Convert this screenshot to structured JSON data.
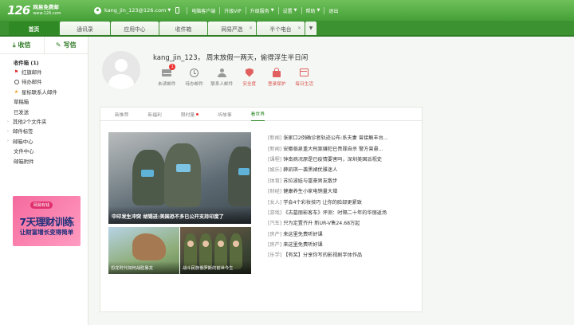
{
  "topbar": {
    "logo_num": "126",
    "logo_name": "网易免费邮",
    "logo_url": "www.126.com",
    "user": "kang_jin_123@126.com",
    "links": [
      "电脑客户端",
      "升级VIP",
      "升级服务",
      "设置",
      "帮助",
      "退出"
    ]
  },
  "tabs": [
    {
      "label": "首页",
      "active": true
    },
    {
      "label": "通讯录",
      "active": false
    },
    {
      "label": "应用中心",
      "active": false
    },
    {
      "label": "收件箱",
      "active": false
    },
    {
      "label": "网易严选",
      "active": false,
      "closable": true
    },
    {
      "label": "半个电台",
      "active": false,
      "closable": true
    }
  ],
  "sidebar": {
    "receive": "收信",
    "write": "写信",
    "items": [
      {
        "label": "收件箱 (1)",
        "icon": "none"
      },
      {
        "label": "红旗邮件",
        "icon": "flag-icon"
      },
      {
        "label": "待办邮件",
        "icon": "clock-icon"
      },
      {
        "label": "星标联系人邮件",
        "icon": "star-icon"
      },
      {
        "label": "草稿箱",
        "icon": "none"
      },
      {
        "label": "已发送",
        "icon": "none"
      },
      {
        "label": "其他2个文件夹",
        "icon": "arrow"
      },
      {
        "label": "邮件标签",
        "icon": "arrow"
      },
      {
        "label": "邮箱中心",
        "icon": "arrow"
      },
      {
        "label": "文件中心",
        "icon": "none"
      },
      {
        "label": "邮箱附件",
        "icon": "none"
      }
    ],
    "ad": {
      "badge": "网易有钱",
      "line1": "7天理财训练",
      "line2": "让财富增长变得简单"
    }
  },
  "greeting": "kang_jin_123， 周末放假一两天，偷得浮生半日闲",
  "shortcuts": [
    {
      "label": "未读邮件",
      "icon": "mail-icon",
      "badge": "1"
    },
    {
      "label": "待办邮件",
      "icon": "clock-icon"
    },
    {
      "label": "联系人邮件",
      "icon": "contact-icon"
    },
    {
      "label": "安全度",
      "icon": "shield-icon"
    },
    {
      "label": "登录保护",
      "icon": "lock-icon"
    },
    {
      "label": "每日生活",
      "icon": "calendar-icon"
    }
  ],
  "news": {
    "tabs": [
      "新推荐",
      "新福利",
      "限时量",
      "听故事",
      "看世界"
    ],
    "active_tab": "看世界",
    "big_caption": "中印发生冲突 胡锡进:美国恐不多已公开支持印度了",
    "small_captions": [
      "恐龙时代如何战胜暴龙",
      "战斗民族俄罗斯的前世今生"
    ],
    "headlines": [
      {
        "cat": "[新闻]",
        "text": "张家口2例确诊者轨迹公布:系夫妻 曾接触丰台..."
      },
      {
        "cat": "[新闻]",
        "text": "安徽临泉重大刑案嫌犯已畏罪自杀 警方曾悬..."
      },
      {
        "cat": "[课程]",
        "text": "钟南病况原是已疫情要害吗，深圳美国派视史"
      },
      {
        "cat": "[娱乐]",
        "text": "薛凯琪一袭黑裙优雅迷人"
      },
      {
        "cat": "[体育]",
        "text": "苏拉波娃与富豪男友散步"
      },
      {
        "cat": "[财经]",
        "text": "健康养生小家电销量大增"
      },
      {
        "cat": "[女人]",
        "text": "学会4个彩妆技巧 让你的脸部更紧致"
      },
      {
        "cat": "[游戏]",
        "text": "《古墓丽影客车》评测：时隔二十年的华丽返场"
      },
      {
        "cat": "[汽车]",
        "text": "只为定置齐升 新UR-V售24.68万起"
      },
      {
        "cat": "[房产]",
        "text": "来这里免费听好课"
      },
      {
        "cat": "[房产]",
        "text": "来这里免费听好课"
      },
      {
        "cat": "[乐学]",
        "text": "【有奖】分享你写的影视剧字体作品"
      }
    ]
  },
  "colors": {
    "brand": "#45a038",
    "active_tab": "#2f8a26",
    "alert": "#e33"
  }
}
